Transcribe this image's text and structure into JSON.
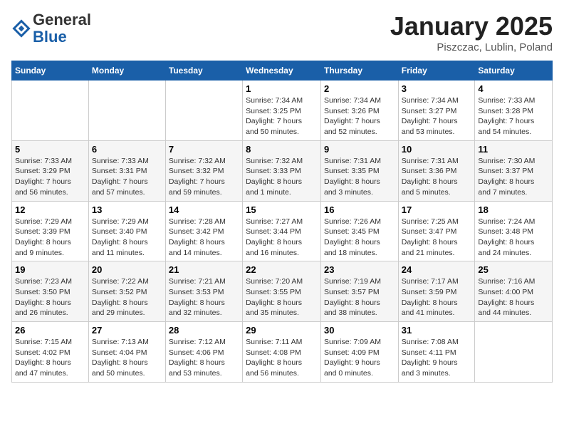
{
  "header": {
    "logo_general": "General",
    "logo_blue": "Blue",
    "title": "January 2025",
    "subtitle": "Piszczac, Lublin, Poland"
  },
  "days_of_week": [
    "Sunday",
    "Monday",
    "Tuesday",
    "Wednesday",
    "Thursday",
    "Friday",
    "Saturday"
  ],
  "weeks": [
    [
      {
        "day": "",
        "info": ""
      },
      {
        "day": "",
        "info": ""
      },
      {
        "day": "",
        "info": ""
      },
      {
        "day": "1",
        "info": "Sunrise: 7:34 AM\nSunset: 3:25 PM\nDaylight: 7 hours\nand 50 minutes."
      },
      {
        "day": "2",
        "info": "Sunrise: 7:34 AM\nSunset: 3:26 PM\nDaylight: 7 hours\nand 52 minutes."
      },
      {
        "day": "3",
        "info": "Sunrise: 7:34 AM\nSunset: 3:27 PM\nDaylight: 7 hours\nand 53 minutes."
      },
      {
        "day": "4",
        "info": "Sunrise: 7:33 AM\nSunset: 3:28 PM\nDaylight: 7 hours\nand 54 minutes."
      }
    ],
    [
      {
        "day": "5",
        "info": "Sunrise: 7:33 AM\nSunset: 3:29 PM\nDaylight: 7 hours\nand 56 minutes."
      },
      {
        "day": "6",
        "info": "Sunrise: 7:33 AM\nSunset: 3:31 PM\nDaylight: 7 hours\nand 57 minutes."
      },
      {
        "day": "7",
        "info": "Sunrise: 7:32 AM\nSunset: 3:32 PM\nDaylight: 7 hours\nand 59 minutes."
      },
      {
        "day": "8",
        "info": "Sunrise: 7:32 AM\nSunset: 3:33 PM\nDaylight: 8 hours\nand 1 minute."
      },
      {
        "day": "9",
        "info": "Sunrise: 7:31 AM\nSunset: 3:35 PM\nDaylight: 8 hours\nand 3 minutes."
      },
      {
        "day": "10",
        "info": "Sunrise: 7:31 AM\nSunset: 3:36 PM\nDaylight: 8 hours\nand 5 minutes."
      },
      {
        "day": "11",
        "info": "Sunrise: 7:30 AM\nSunset: 3:37 PM\nDaylight: 8 hours\nand 7 minutes."
      }
    ],
    [
      {
        "day": "12",
        "info": "Sunrise: 7:29 AM\nSunset: 3:39 PM\nDaylight: 8 hours\nand 9 minutes."
      },
      {
        "day": "13",
        "info": "Sunrise: 7:29 AM\nSunset: 3:40 PM\nDaylight: 8 hours\nand 11 minutes."
      },
      {
        "day": "14",
        "info": "Sunrise: 7:28 AM\nSunset: 3:42 PM\nDaylight: 8 hours\nand 14 minutes."
      },
      {
        "day": "15",
        "info": "Sunrise: 7:27 AM\nSunset: 3:44 PM\nDaylight: 8 hours\nand 16 minutes."
      },
      {
        "day": "16",
        "info": "Sunrise: 7:26 AM\nSunset: 3:45 PM\nDaylight: 8 hours\nand 18 minutes."
      },
      {
        "day": "17",
        "info": "Sunrise: 7:25 AM\nSunset: 3:47 PM\nDaylight: 8 hours\nand 21 minutes."
      },
      {
        "day": "18",
        "info": "Sunrise: 7:24 AM\nSunset: 3:48 PM\nDaylight: 8 hours\nand 24 minutes."
      }
    ],
    [
      {
        "day": "19",
        "info": "Sunrise: 7:23 AM\nSunset: 3:50 PM\nDaylight: 8 hours\nand 26 minutes."
      },
      {
        "day": "20",
        "info": "Sunrise: 7:22 AM\nSunset: 3:52 PM\nDaylight: 8 hours\nand 29 minutes."
      },
      {
        "day": "21",
        "info": "Sunrise: 7:21 AM\nSunset: 3:53 PM\nDaylight: 8 hours\nand 32 minutes."
      },
      {
        "day": "22",
        "info": "Sunrise: 7:20 AM\nSunset: 3:55 PM\nDaylight: 8 hours\nand 35 minutes."
      },
      {
        "day": "23",
        "info": "Sunrise: 7:19 AM\nSunset: 3:57 PM\nDaylight: 8 hours\nand 38 minutes."
      },
      {
        "day": "24",
        "info": "Sunrise: 7:17 AM\nSunset: 3:59 PM\nDaylight: 8 hours\nand 41 minutes."
      },
      {
        "day": "25",
        "info": "Sunrise: 7:16 AM\nSunset: 4:00 PM\nDaylight: 8 hours\nand 44 minutes."
      }
    ],
    [
      {
        "day": "26",
        "info": "Sunrise: 7:15 AM\nSunset: 4:02 PM\nDaylight: 8 hours\nand 47 minutes."
      },
      {
        "day": "27",
        "info": "Sunrise: 7:13 AM\nSunset: 4:04 PM\nDaylight: 8 hours\nand 50 minutes."
      },
      {
        "day": "28",
        "info": "Sunrise: 7:12 AM\nSunset: 4:06 PM\nDaylight: 8 hours\nand 53 minutes."
      },
      {
        "day": "29",
        "info": "Sunrise: 7:11 AM\nSunset: 4:08 PM\nDaylight: 8 hours\nand 56 minutes."
      },
      {
        "day": "30",
        "info": "Sunrise: 7:09 AM\nSunset: 4:09 PM\nDaylight: 9 hours\nand 0 minutes."
      },
      {
        "day": "31",
        "info": "Sunrise: 7:08 AM\nSunset: 4:11 PM\nDaylight: 9 hours\nand 3 minutes."
      },
      {
        "day": "",
        "info": ""
      }
    ]
  ]
}
